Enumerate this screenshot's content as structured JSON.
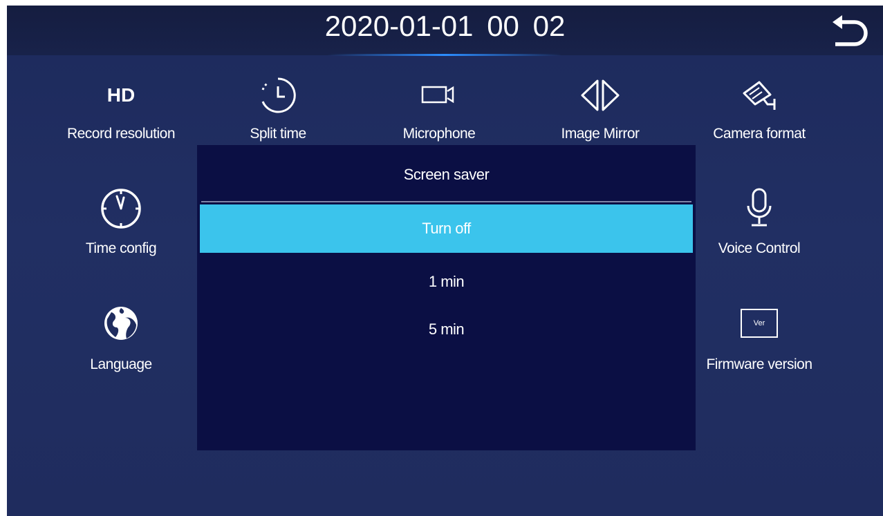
{
  "header": {
    "datetime": "2020-01-01  00 02",
    "back_icon": "back-arrow-icon"
  },
  "menu": {
    "record_resolution": {
      "icon_text": "HD",
      "label": "Record resolution",
      "icon": "hd-icon"
    },
    "split_time": {
      "label": "Split time",
      "icon": "timer-icon"
    },
    "microphone": {
      "label": "Microphone",
      "icon": "video-camera-icon"
    },
    "image_mirror": {
      "label": "Image Mirror",
      "icon": "mirror-arrows-icon"
    },
    "camera_format": {
      "label": "Camera format",
      "icon": "security-camera-icon"
    },
    "time_config": {
      "label": "Time config",
      "icon": "clock-icon"
    },
    "voice_control": {
      "label": "Voice Control",
      "icon": "microphone-icon"
    },
    "language": {
      "label": "Language",
      "icon": "globe-icon"
    },
    "firmware_version": {
      "icon_text": "Ver",
      "label": "Firmware version",
      "icon": "version-icon"
    }
  },
  "dialog": {
    "title": "Screen saver",
    "options": [
      "Turn off",
      "1 min",
      "5 min"
    ],
    "selected_index": 0
  },
  "colors": {
    "background": "#1f2c5e",
    "topbar": "#161f44",
    "dialog": "#0b0f44",
    "selected": "#3bc4ec",
    "accent_glow": "#2c8dff"
  }
}
